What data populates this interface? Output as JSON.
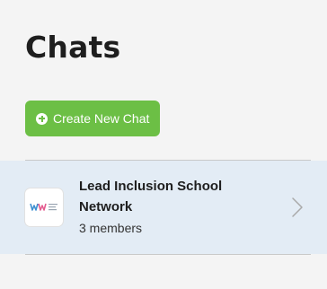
{
  "header": {
    "title": "Chats"
  },
  "actions": {
    "create_label": "Create New Chat",
    "accent_color": "#6cbf45"
  },
  "chats": [
    {
      "name": "Lead Inclusion School Network",
      "members": "3 members",
      "avatar_icon": "group-logo-icon",
      "selected": true
    }
  ],
  "colors": {
    "page_background": "#f4f4f4",
    "selected_row_background": "#e3ecf5",
    "divider": "#c9c9c9"
  },
  "icons": {
    "create": "plus-circle-icon",
    "open_chat": "chevron-right-icon"
  }
}
